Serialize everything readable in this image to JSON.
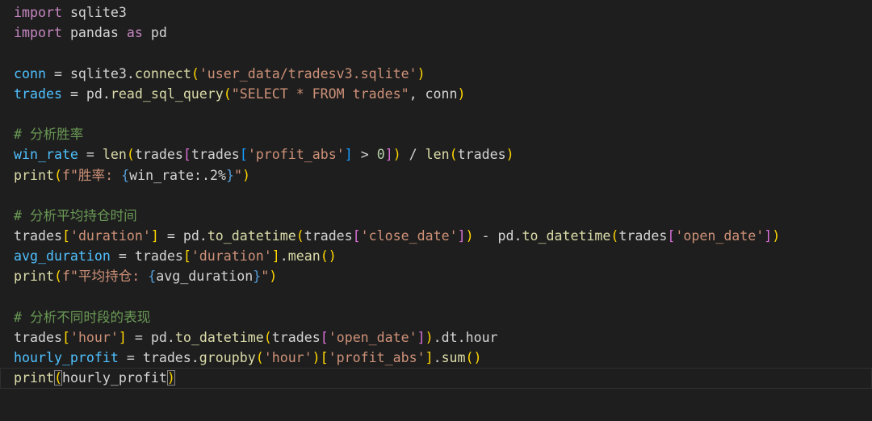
{
  "colors": {
    "background": "#1e1e1e",
    "text": "#d4d4d4",
    "keyword": "#c586c0",
    "function": "#dcdcaa",
    "variable": "#9cdcfe",
    "string": "#ce9178",
    "number": "#b5cea8",
    "comment": "#6a9955",
    "bracket_level1": "#ffd700",
    "bracket_level2": "#da70d6",
    "bracket_level3": "#179fff"
  },
  "editor": {
    "current_line": 18,
    "lines": [
      [
        [
          "kw",
          "import"
        ],
        [
          "t",
          " sqlite3"
        ]
      ],
      [
        [
          "kw",
          "import"
        ],
        [
          "t",
          " pandas "
        ],
        [
          "kw",
          "as"
        ],
        [
          "t",
          " pd"
        ]
      ],
      [],
      [
        [
          "vardef",
          "conn"
        ],
        [
          "t",
          " = sqlite3."
        ],
        [
          "fn",
          "connect"
        ],
        [
          "b1",
          "("
        ],
        [
          "str",
          "'user_data/tradesv3.sqlite'"
        ],
        [
          "b1",
          ")"
        ]
      ],
      [
        [
          "vardef",
          "trades"
        ],
        [
          "t",
          " = pd."
        ],
        [
          "fn",
          "read_sql_query"
        ],
        [
          "b1",
          "("
        ],
        [
          "str",
          "\"SELECT * FROM trades\""
        ],
        [
          "t",
          ", conn"
        ],
        [
          "b1",
          ")"
        ]
      ],
      [],
      [
        [
          "cmt",
          "# 分析胜率"
        ]
      ],
      [
        [
          "vardef",
          "win_rate"
        ],
        [
          "t",
          " = "
        ],
        [
          "fn",
          "len"
        ],
        [
          "b1",
          "("
        ],
        [
          "t",
          "trades"
        ],
        [
          "b2",
          "["
        ],
        [
          "t",
          "trades"
        ],
        [
          "b3",
          "["
        ],
        [
          "str",
          "'profit_abs'"
        ],
        [
          "b3",
          "]"
        ],
        [
          "t",
          " > "
        ],
        [
          "num",
          "0"
        ],
        [
          "b2",
          "]"
        ],
        [
          "b1",
          ")"
        ],
        [
          "t",
          " / "
        ],
        [
          "fn",
          "len"
        ],
        [
          "b1",
          "("
        ],
        [
          "t",
          "trades"
        ],
        [
          "b1",
          ")"
        ]
      ],
      [
        [
          "fn",
          "print"
        ],
        [
          "b1",
          "("
        ],
        [
          "str",
          "f\"胜率: "
        ],
        [
          "fmtbrace",
          "{"
        ],
        [
          "t",
          "win_rate:.2%"
        ],
        [
          "fmtbrace",
          "}"
        ],
        [
          "str",
          "\""
        ],
        [
          "b1",
          ")"
        ]
      ],
      [],
      [
        [
          "cmt",
          "# 分析平均持仓时间"
        ]
      ],
      [
        [
          "t",
          "trades"
        ],
        [
          "b1",
          "["
        ],
        [
          "str",
          "'duration'"
        ],
        [
          "b1",
          "]"
        ],
        [
          "t",
          " = pd."
        ],
        [
          "fn",
          "to_datetime"
        ],
        [
          "b1",
          "("
        ],
        [
          "t",
          "trades"
        ],
        [
          "b2",
          "["
        ],
        [
          "str",
          "'close_date'"
        ],
        [
          "b2",
          "]"
        ],
        [
          "b1",
          ")"
        ],
        [
          "t",
          " - pd."
        ],
        [
          "fn",
          "to_datetime"
        ],
        [
          "b1",
          "("
        ],
        [
          "t",
          "trades"
        ],
        [
          "b2",
          "["
        ],
        [
          "str",
          "'open_date'"
        ],
        [
          "b2",
          "]"
        ],
        [
          "b1",
          ")"
        ]
      ],
      [
        [
          "vardef",
          "avg_duration"
        ],
        [
          "t",
          " = trades"
        ],
        [
          "b1",
          "["
        ],
        [
          "str",
          "'duration'"
        ],
        [
          "b1",
          "]"
        ],
        [
          "t",
          "."
        ],
        [
          "fn",
          "mean"
        ],
        [
          "b1",
          "("
        ],
        [
          "b1",
          ")"
        ]
      ],
      [
        [
          "fn",
          "print"
        ],
        [
          "b1",
          "("
        ],
        [
          "str",
          "f\"平均持仓: "
        ],
        [
          "fmtbrace",
          "{"
        ],
        [
          "t",
          "avg_duration"
        ],
        [
          "fmtbrace",
          "}"
        ],
        [
          "str",
          "\""
        ],
        [
          "b1",
          ")"
        ]
      ],
      [],
      [
        [
          "cmt",
          "# 分析不同时段的表现"
        ]
      ],
      [
        [
          "t",
          "trades"
        ],
        [
          "b1",
          "["
        ],
        [
          "str",
          "'hour'"
        ],
        [
          "b1",
          "]"
        ],
        [
          "t",
          " = pd."
        ],
        [
          "fn",
          "to_datetime"
        ],
        [
          "b1",
          "("
        ],
        [
          "t",
          "trades"
        ],
        [
          "b2",
          "["
        ],
        [
          "str",
          "'open_date'"
        ],
        [
          "b2",
          "]"
        ],
        [
          "b1",
          ")"
        ],
        [
          "t",
          ".dt.hour"
        ]
      ],
      [
        [
          "vardef",
          "hourly_profit"
        ],
        [
          "t",
          " = trades."
        ],
        [
          "fn",
          "groupby"
        ],
        [
          "b1",
          "("
        ],
        [
          "str",
          "'hour'"
        ],
        [
          "b1",
          ")"
        ],
        [
          "b1",
          "["
        ],
        [
          "str",
          "'profit_abs'"
        ],
        [
          "b1",
          "]"
        ],
        [
          "t",
          "."
        ],
        [
          "fn",
          "sum"
        ],
        [
          "b1",
          "("
        ],
        [
          "b1",
          ")"
        ]
      ],
      [
        [
          "fn",
          "print"
        ],
        [
          "b1m",
          "("
        ],
        [
          "t",
          "hourly_profit"
        ],
        [
          "b1m",
          ")"
        ]
      ]
    ]
  }
}
